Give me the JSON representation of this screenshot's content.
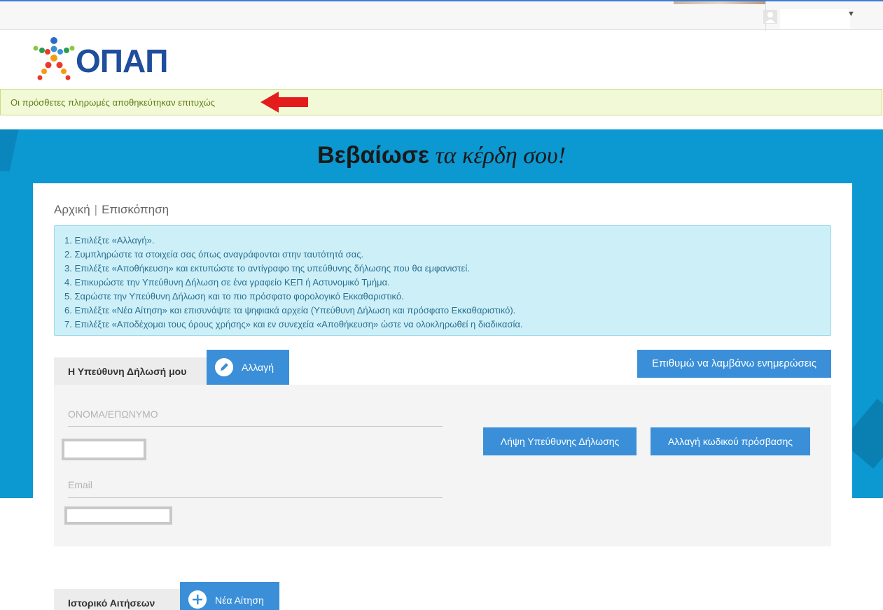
{
  "header": {
    "user_menu": {
      "avatar_icon": "user-avatar-icon",
      "caret_icon": "caret-down-icon"
    }
  },
  "logo": {
    "text": "ΟΠΑΠ"
  },
  "alert": {
    "message": "Οι πρόσθετες πληρωμές αποθηκεύτηκαν επιτυχώς",
    "arrow_color": "#e41c1c"
  },
  "hero": {
    "title_bold": "Βεβαίωσε",
    "title_script": " τα κέρδη σου!"
  },
  "breadcrumb": {
    "home": "Αρχική",
    "separator": "|",
    "current": "Επισκόπηση"
  },
  "instructions": [
    "1. Επιλέξτε «Αλλαγή».",
    "2. Συμπληρώστε τα στοιχεία σας όπως αναγράφονται στην ταυτότητά σας.",
    "3. Επιλέξτε «Αποθήκευση» και εκτυπώστε το αντίγραφο της υπεύθυνης δήλωσης που θα εμφανιστεί.",
    "4. Επικυρώστε την Υπεύθυνη Δήλωση σε ένα γραφείο ΚΕΠ ή Αστυνομικό Τμήμα.",
    "5. Σαρώστε την Υπεύθυνη Δήλωση και το πιο πρόσφατο φορολογικό Εκκαθαριστικό.",
    "6. Επιλέξτε «Νέα Αίτηση» και επισυνάψτε τα ψηφιακά αρχεία (Υπεύθυνη Δήλωση και πρόσφατο Εκκαθαριστικό).",
    "7. Επιλέξτε «Αποδέχομαι τους όρους χρήσης» και εν συνεχεία «Αποθήκευση» ώστε να ολοκληρωθεί η διαδικασία."
  ],
  "declaration": {
    "tab_label": "Η Υπεύθυνη Δήλωσή μου",
    "change_button": "Αλλαγή",
    "updates_button": "Επιθυμώ να λαμβάνω ενημερώσεις",
    "name_label": "ΟΝΟΜΑ/ΕΠΩΝΥΜΟ",
    "email_label": "Email",
    "download_button": "Λήψη Υπεύθυνης Δήλωσης",
    "password_button": "Αλλαγή κωδικού πρόσβασης"
  },
  "history": {
    "tab_label": "Ιστορικό Αιτήσεων",
    "new_button": "Νέα Αίτηση"
  },
  "colors": {
    "primary_blue": "#3a8fd8",
    "hero_blue": "#0c98d1",
    "alert_bg": "#f2f9d7",
    "alert_text": "#5f7f17",
    "info_bg": "#cdf0f8",
    "logo_blue": "#1e4e9c"
  }
}
